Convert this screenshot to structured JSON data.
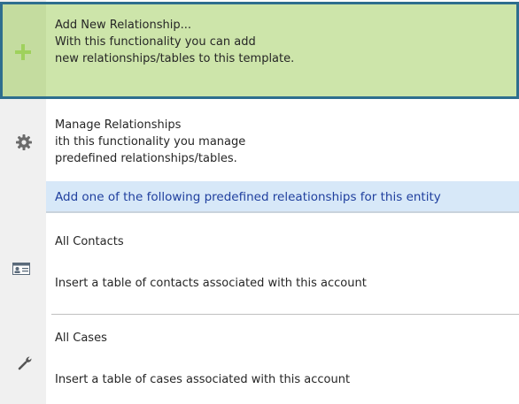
{
  "menu": {
    "add_new": {
      "title": "Add New Relationship...",
      "line1": "With this functionality you can add",
      "line2": "new relationships/tables to this template.",
      "icon": "plus-icon"
    },
    "manage": {
      "title": "Manage Relationships",
      "line1": "ith this functionality you manage",
      "line2": "predefined relationships/tables.",
      "icon": "gear-icon"
    },
    "section_header": "Add one of the following predefined releationships for this entity",
    "contacts": {
      "title": "All Contacts",
      "description": "Insert a table of contacts associated with this account",
      "icon": "contact-card-icon"
    },
    "cases": {
      "title": "All Cases",
      "description": "Insert a table of cases associated with this account",
      "icon": "wrench-icon"
    }
  },
  "colors": {
    "highlight_background": "#cde5aa",
    "highlight_border": "#2e6e8e",
    "section_header_background": "#d7e8f8",
    "section_header_text": "#1f3f9e",
    "plus_icon": "#9fd15c"
  }
}
